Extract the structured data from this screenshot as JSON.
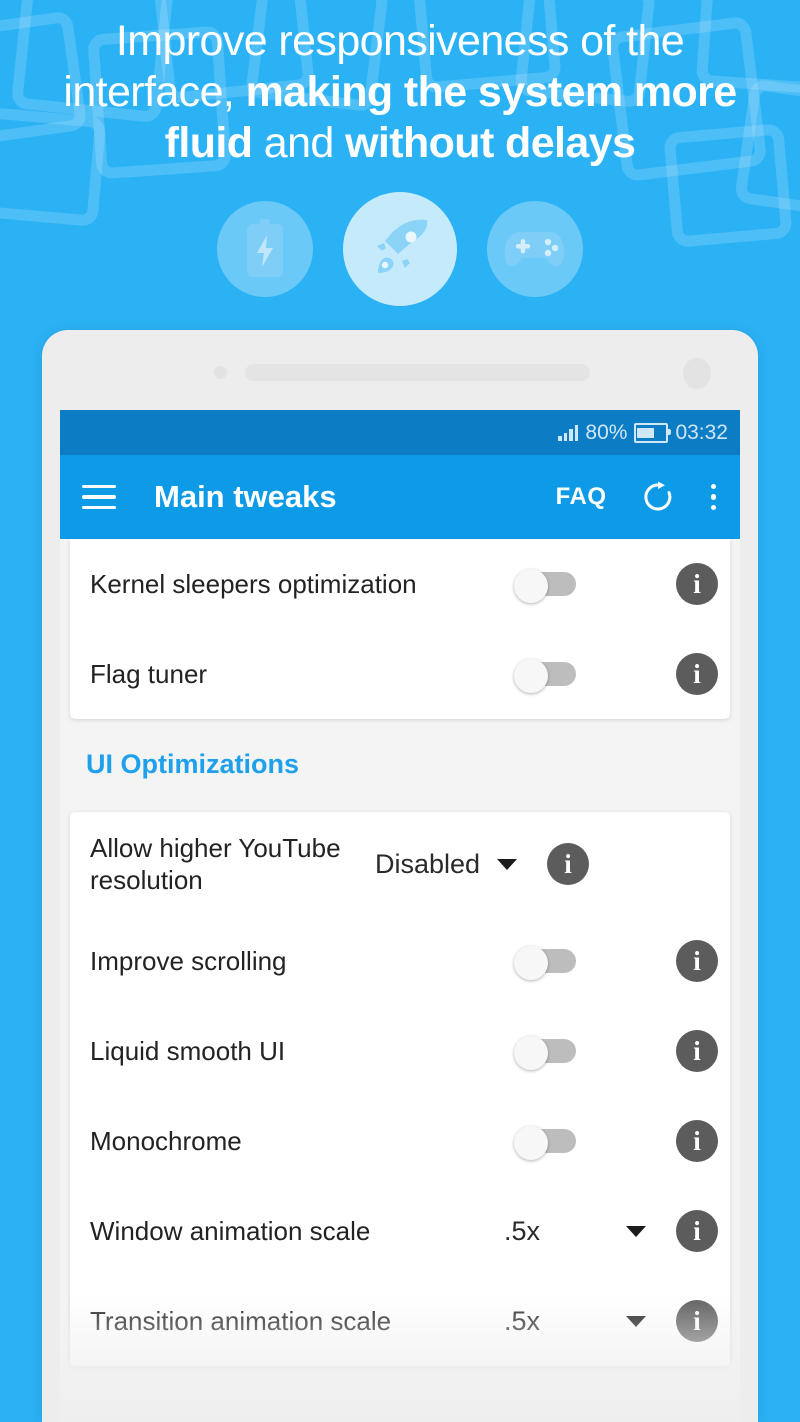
{
  "theme": {
    "background_blue": "#2BB2F5",
    "toolbar_blue": "#0D9BE8",
    "statusbar_blue": "#0C7CC4",
    "section_title_blue": "#1FA0EB",
    "info_gray": "#5C5C5C",
    "card_white": "#FFFFFF"
  },
  "promo": {
    "headline_line1": "Improve responsiveness of the",
    "headline_line2_a": "interface, ",
    "headline_line2_b": "making the system more",
    "headline_line3_a": "fluid",
    "headline_line3_b": " and ",
    "headline_line3_c": "without delays",
    "badges": [
      {
        "icon": "battery-icon",
        "name": "battery"
      },
      {
        "icon": "rocket-icon",
        "name": "rocket"
      },
      {
        "icon": "gamepad-icon",
        "name": "gamepad"
      }
    ]
  },
  "statusbar": {
    "signal_icon": "signal-bars-icon",
    "battery_percent": "80%",
    "battery_icon": "battery-icon",
    "time": "03:32"
  },
  "toolbar": {
    "menu_icon": "hamburger-menu-icon",
    "title": "Main tweaks",
    "faq_label": "FAQ",
    "refresh_icon": "refresh-icon",
    "overflow_icon": "more-vertical-icon"
  },
  "cards": [
    {
      "id": "main-tweaks-card",
      "rows": [
        {
          "label": "Kernel sleepers optimization",
          "control": "toggle",
          "state": "off",
          "info": "i"
        },
        {
          "label": "Flag tuner",
          "control": "toggle",
          "state": "off",
          "info": "i"
        }
      ]
    },
    {
      "id": "ui-optimizations-card",
      "section_title": "UI Optimizations",
      "rows": [
        {
          "label": "Allow higher YouTube resolution",
          "control": "dropdown",
          "value": "Disabled",
          "info": "i"
        },
        {
          "label": "Improve scrolling",
          "control": "toggle",
          "state": "off",
          "info": "i"
        },
        {
          "label": "Liquid smooth UI",
          "control": "toggle",
          "state": "off",
          "info": "i"
        },
        {
          "label": "Monochrome",
          "control": "toggle",
          "state": "off",
          "info": "i"
        },
        {
          "label": "Window animation scale",
          "control": "dropdown",
          "value": ".5x",
          "info": "i"
        },
        {
          "label": "Transition animation scale",
          "control": "dropdown",
          "value": ".5x",
          "info": "i"
        }
      ]
    }
  ]
}
